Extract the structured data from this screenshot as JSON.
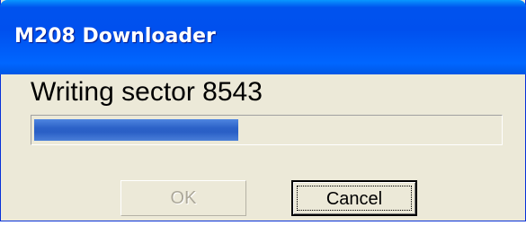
{
  "window": {
    "title": "M208 Downloader"
  },
  "status": {
    "text": "Writing sector 8543"
  },
  "progress": {
    "fraction": 0.44
  },
  "buttons": {
    "ok_label": "OK",
    "ok_enabled": false,
    "cancel_label": "Cancel"
  },
  "colors": {
    "titlebar": "#0058ee",
    "progress_fill": "#2c62c8",
    "dialog_background": "#ece9d8"
  }
}
